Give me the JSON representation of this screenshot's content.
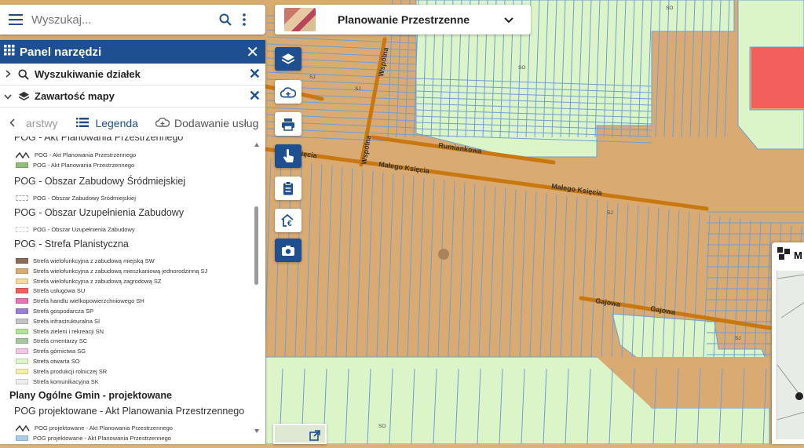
{
  "search": {
    "placeholder": "Wyszukaj..."
  },
  "topic": {
    "label": "Planowanie Przestrzenne"
  },
  "panel": {
    "title": "Panel narzędzi",
    "sections": [
      {
        "label": "Wyszukiwanie działek"
      },
      {
        "label": "Zawartość mapy"
      }
    ],
    "tabs": {
      "partial": "arstwy",
      "active": "Legenda",
      "next": "Dodawanie usług"
    }
  },
  "legend": {
    "partial_header": "POG - Akt Planowania Przestrzennego",
    "akt_rows": [
      "POG - Akt Planowania Przestrzennego",
      "POG - Akt Planowania Przestrzennego"
    ],
    "obszar_zabudowy_header": "POG - Obszar Zabudowy Śródmiejskiej",
    "obszar_zabudowy_row": "POG - Obszar Zabudowy Śródmiejskiej",
    "uzupelnienia_header": "POG - Obszar Uzupełnienia Zabudowy",
    "uzupelnienia_row": "POG - Obszar Uzupełnienia Zabudowy",
    "strefa_header": "POG - Strefa Planistyczna",
    "strefy": [
      {
        "label": "Strefa wielofunkcyjna z zabudową miejską SW",
        "color": "#8c6a54"
      },
      {
        "label": "Strefa wielofunkcyjna z zabudową mieszkaniową jednorodzinną SJ",
        "color": "#d9ab73"
      },
      {
        "label": "Strefa wielofunkcyjna z zabudową zagrodową SZ",
        "color": "#f2d9a0"
      },
      {
        "label": "Strefa usługowa SU",
        "color": "#f25f5c"
      },
      {
        "label": "Strefa handlu wielkopowierzchniowego SH",
        "color": "#e873b5"
      },
      {
        "label": "Strefa gospodarcza SP",
        "color": "#9b7fd1"
      },
      {
        "label": "Strefa infrastrukturalna SI",
        "color": "#c4c4c4"
      },
      {
        "label": "Strefa zieleni i rekreacji SN",
        "color": "#b4e39a"
      },
      {
        "label": "Strefa cmentarzy SC",
        "color": "#a8c8a2"
      },
      {
        "label": "Strefa górnictwa SG",
        "color": "#f3c6e4"
      },
      {
        "label": "Strefa otwarta SO",
        "color": "#dcf5c8"
      },
      {
        "label": "Strefa produkcji rolniczej SR",
        "color": "#f5f0a8"
      },
      {
        "label": "Strefa komunikacyjna SK",
        "color": "#ededed"
      }
    ],
    "plany_header": "Plany Ogólne Gmin - projektowane",
    "projektowane_header": "POG projektowane - Akt Planowania Przestrzennego",
    "projektowane_rows": [
      "POG projektowane - Akt Planowania Przestrzennego",
      "POG projektowane - Akt Planowania Przestrzennego"
    ]
  },
  "map": {
    "streets": {
      "wspolna": "Wspólna",
      "rumiankowa": "Rumiankowa",
      "malego_ksiecia_1": "Małego Księcia",
      "malego_ksiecia_2": "Małego Księcia",
      "ksiecia_partial": "Księcia",
      "gajowa_1": "Gajowa",
      "gajowa_2": "Gajowa"
    },
    "zone_labels": {
      "so_top": "SO",
      "so_mid": "SO",
      "sj_1": "SJ",
      "sj_2": "SJ",
      "sj_3": "SJ",
      "sj_4": "SJ",
      "so_bottom": "SO"
    }
  },
  "right_panel": {
    "label_partial": "M"
  },
  "colors": {
    "accent": "#1d4f91",
    "sj": "#d9ab73",
    "so": "#dcf5c8",
    "su": "#f25f5c",
    "road": "#c8780f",
    "parcel_line": "#6d9ed9"
  }
}
